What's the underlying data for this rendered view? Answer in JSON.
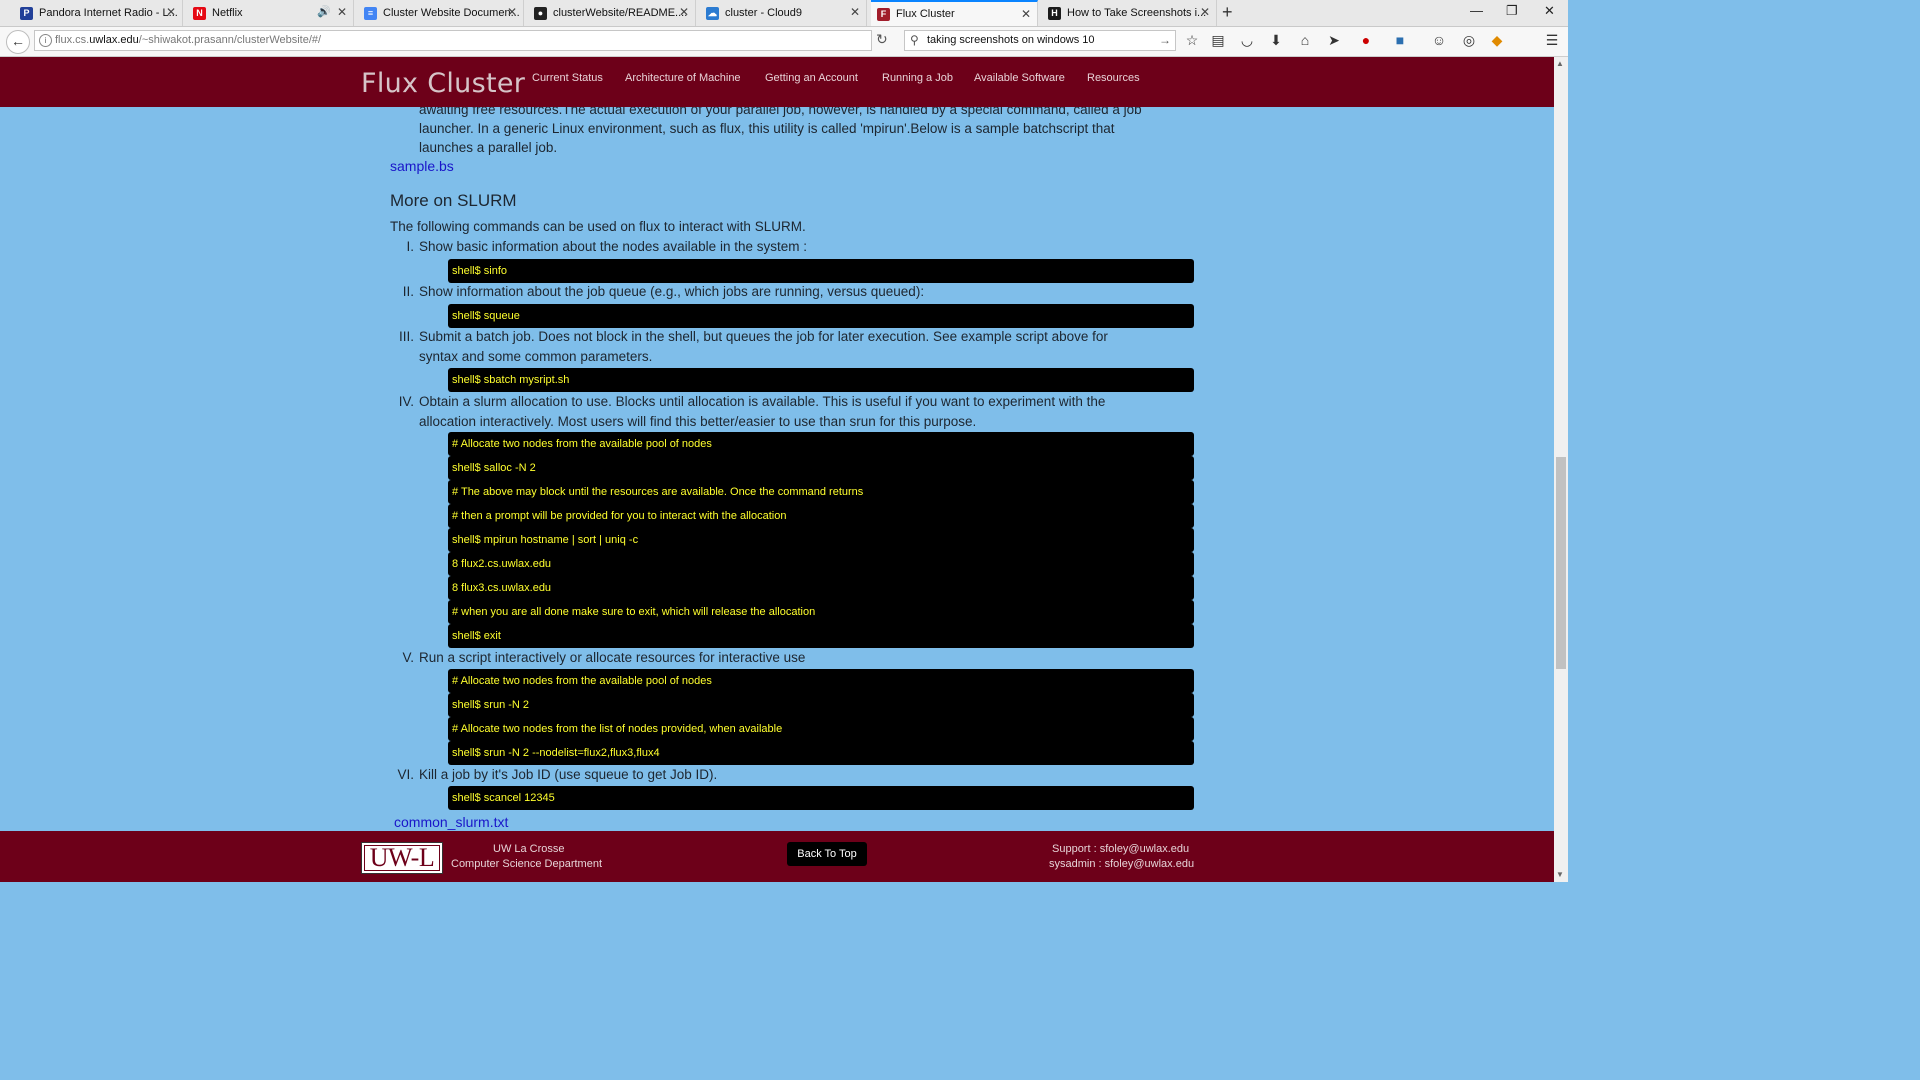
{
  "browser": {
    "tabs": [
      {
        "label": "Pandora Internet Radio - L...",
        "icon": "pandora-icon",
        "color": "#224099",
        "glyph": "P"
      },
      {
        "label": "Netflix",
        "icon": "netflix-icon",
        "color": "#e50914",
        "glyph": "N"
      },
      {
        "label": "Cluster Website Documen...",
        "icon": "google-docs-icon",
        "color": "#4285f4",
        "glyph": "≡"
      },
      {
        "label": "clusterWebsite/README....",
        "icon": "github-icon",
        "color": "#222222",
        "glyph": "●"
      },
      {
        "label": "cluster - Cloud9",
        "icon": "cloud9-icon",
        "color": "#2b7bd1",
        "glyph": "☁"
      },
      {
        "label": "Flux Cluster",
        "icon": "flux-favicon-icon",
        "color": "#a11d2b",
        "glyph": "F"
      },
      {
        "label": "How to Take Screenshots i...",
        "icon": "htg-icon",
        "color": "#1b1b1b",
        "glyph": "H"
      }
    ],
    "url_prefix": "flux.cs.",
    "url_host": "uwlax.edu",
    "url_path": "/~shiwakot.prasann/clusterWebsite/#/",
    "search_value": "taking screenshots on windows 10"
  },
  "site": {
    "brand": "Flux Cluster",
    "nav": [
      "Current Status",
      "Architecture of Machine",
      "Getting an Account",
      "Running a Job",
      "Available Software",
      "Resources"
    ]
  },
  "content": {
    "intro_lines": [
      "awaiting free resources.The actual execution of your parallel job, however, is handled by a special command, called a job",
      "launcher. In a generic Linux environment, such as flux, this utility is called 'mpirun'.Below is a sample batchscript that",
      "launches a parallel job."
    ],
    "sample_link": "sample.bs",
    "heading": "More on SLURM",
    "lead": "The following commands can be used on flux to interact with SLURM.",
    "items": [
      {
        "num": "I.",
        "lines": [
          "Show basic information about the nodes available in the system :"
        ]
      },
      {
        "num": "II.",
        "lines": [
          "Show information about the job queue (e.g., which jobs are running, versus queued):"
        ]
      },
      {
        "num": "III.",
        "lines": [
          "Submit a batch job. Does not block in the shell, but queues the job for later execution. See example script above for",
          "syntax and some common parameters."
        ]
      },
      {
        "num": "IV.",
        "lines": [
          "Obtain a slurm allocation to use. Blocks until allocation is available. This is useful if you want to experiment with the",
          "allocation interactively. Most users will find this better/easier to use than srun for this purpose."
        ]
      },
      {
        "num": "V.",
        "lines": [
          "Run a script interactively or allocate resources for interactive use"
        ]
      },
      {
        "num": "VI.",
        "lines": [
          "Kill a job by it's Job ID (use squeue to get Job ID)."
        ]
      }
    ],
    "code_blocks": [
      [
        "shell$ sinfo"
      ],
      [
        "shell$ squeue"
      ],
      [
        "shell$ sbatch mysript.sh"
      ],
      [
        "# Allocate two nodes from the available pool of nodes",
        "shell$ salloc -N 2",
        "# The above may block until the resources are available. Once the command returns",
        "# then a prompt will be provided for you to interact with the allocation",
        "shell$ mpirun hostname | sort | uniq -c",
        "8 flux2.cs.uwlax.edu",
        "8 flux3.cs.uwlax.edu",
        "# when you are all done make sure to exit, which will release the allocation",
        "shell$ exit"
      ],
      [
        "# Allocate two nodes from the available pool of nodes",
        "shell$ srun -N 2",
        "# Allocate two nodes from the list of nodes provided, when available",
        "shell$ srun -N 2 --nodelist=flux2,flux3,flux4"
      ],
      [
        "shell$ scancel 12345"
      ]
    ],
    "bottom_link": "common_slurm.txt"
  },
  "footer": {
    "logo": "UW-L",
    "org_line1": "UW La Crosse",
    "org_line2": "Computer Science Department",
    "back_to_top": "Back To Top",
    "support": "Support : sfoley@uwlax.edu",
    "sysadmin": "sysadmin : sfoley@uwlax.edu"
  },
  "colors": {
    "header_bg": "#6d0019",
    "page_bg": "#7fbeea",
    "code_bg": "#000000",
    "code_text": "#ffff2e",
    "link": "#1a16c9"
  }
}
